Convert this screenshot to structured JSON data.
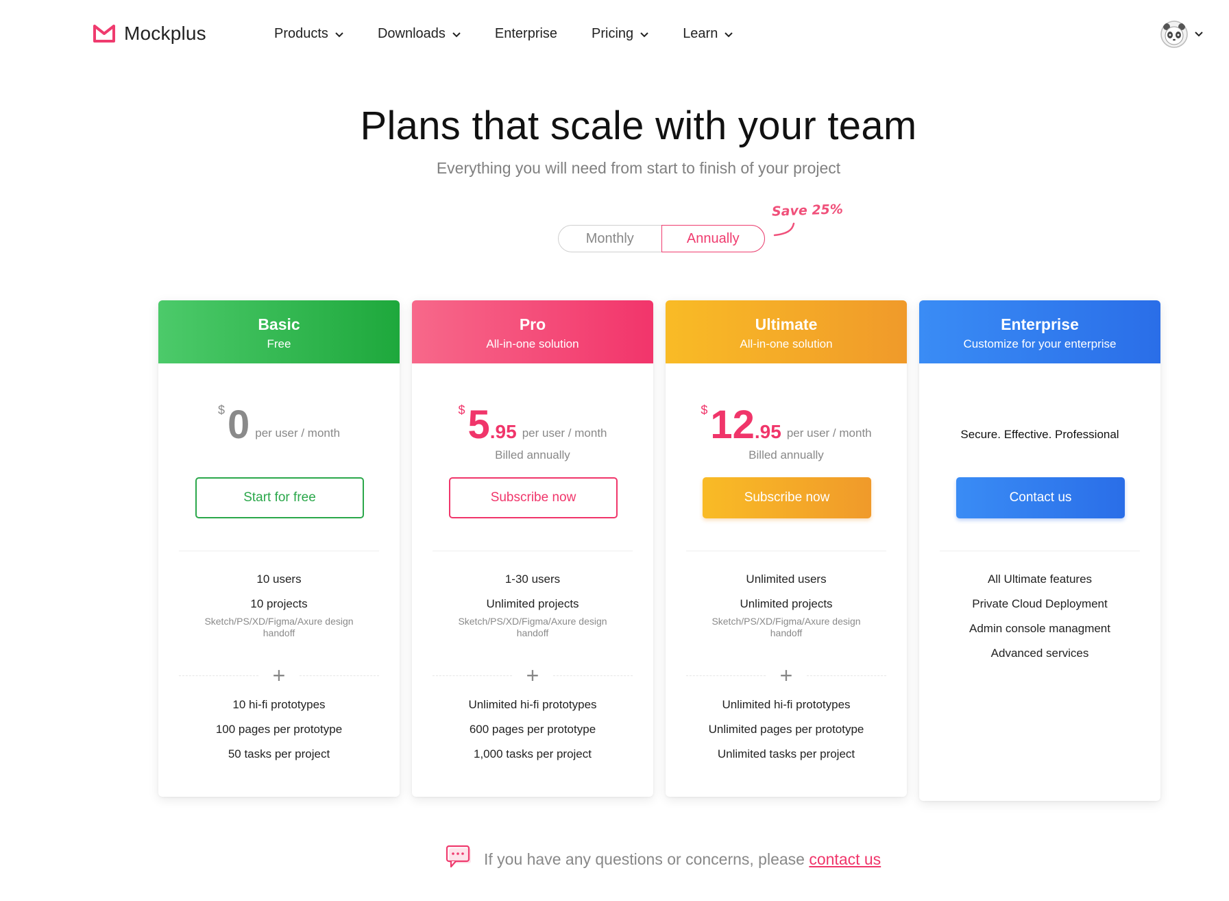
{
  "brand": {
    "name": "Mockplus",
    "accent": "#ef3b6e"
  },
  "nav": [
    {
      "label": "Products",
      "dropdown": true
    },
    {
      "label": "Downloads",
      "dropdown": true
    },
    {
      "label": "Enterprise",
      "dropdown": false
    },
    {
      "label": "Pricing",
      "dropdown": true
    },
    {
      "label": "Learn",
      "dropdown": true
    }
  ],
  "user": {
    "avatar_icon": "panda-avatar-icon"
  },
  "hero": {
    "title": "Plans that scale with your team",
    "subtitle": "Everything you will need from start to finish of your project"
  },
  "billing_toggle": {
    "options": [
      "Monthly",
      "Annually"
    ],
    "selected": "Annually",
    "save_note": "Save 25%"
  },
  "plans": [
    {
      "name": "Basic",
      "tagline": "Free",
      "color": "#2aa74a",
      "currency": "$",
      "price_int": "0",
      "price_dec": "",
      "per": "per user / month",
      "billed": "",
      "button": "Start for free",
      "features_top": [
        "10 users",
        "10 projects"
      ],
      "handoff": "Sketch/PS/XD/Figma/Axure design handoff",
      "features_bottom": [
        "10 hi-fi prototypes",
        "100 pages per prototype",
        "50 tasks per project"
      ]
    },
    {
      "name": "Pro",
      "tagline": "All-in-one solution",
      "color": "#f0356a",
      "currency": "$",
      "price_int": "5",
      "price_dec": ".95",
      "per": "per user / month",
      "billed": "Billed annually",
      "button": "Subscribe now",
      "features_top": [
        "1-30 users",
        "Unlimited projects"
      ],
      "handoff": "Sketch/PS/XD/Figma/Axure design handoff",
      "features_bottom": [
        "Unlimited hi-fi prototypes",
        "600 pages per prototype",
        "1,000 tasks per project"
      ]
    },
    {
      "name": "Ultimate",
      "tagline": "All-in-one solution",
      "color": "#f09a2a",
      "currency": "$",
      "price_int": "12",
      "price_dec": ".95",
      "per": "per user / month",
      "billed": "Billed annually",
      "button": "Subscribe now",
      "features_top": [
        "Unlimited users",
        "Unlimited projects"
      ],
      "handoff": "Sketch/PS/XD/Figma/Axure design handoff",
      "features_bottom": [
        "Unlimited hi-fi prototypes",
        "Unlimited pages per prototype",
        "Unlimited tasks per project"
      ]
    },
    {
      "name": "Enterprise",
      "tagline": "Customize for your enterprise",
      "color": "#2a6ee8",
      "description": "Secure. Effective. Professional",
      "button": "Contact us",
      "features": [
        "All Ultimate features",
        "Private Cloud Deployment",
        "Admin console managment",
        "Advanced services"
      ]
    }
  ],
  "footer": {
    "text": "If you have any questions or concerns, please",
    "link": "contact us",
    "icon": "chat-bubble-icon"
  }
}
